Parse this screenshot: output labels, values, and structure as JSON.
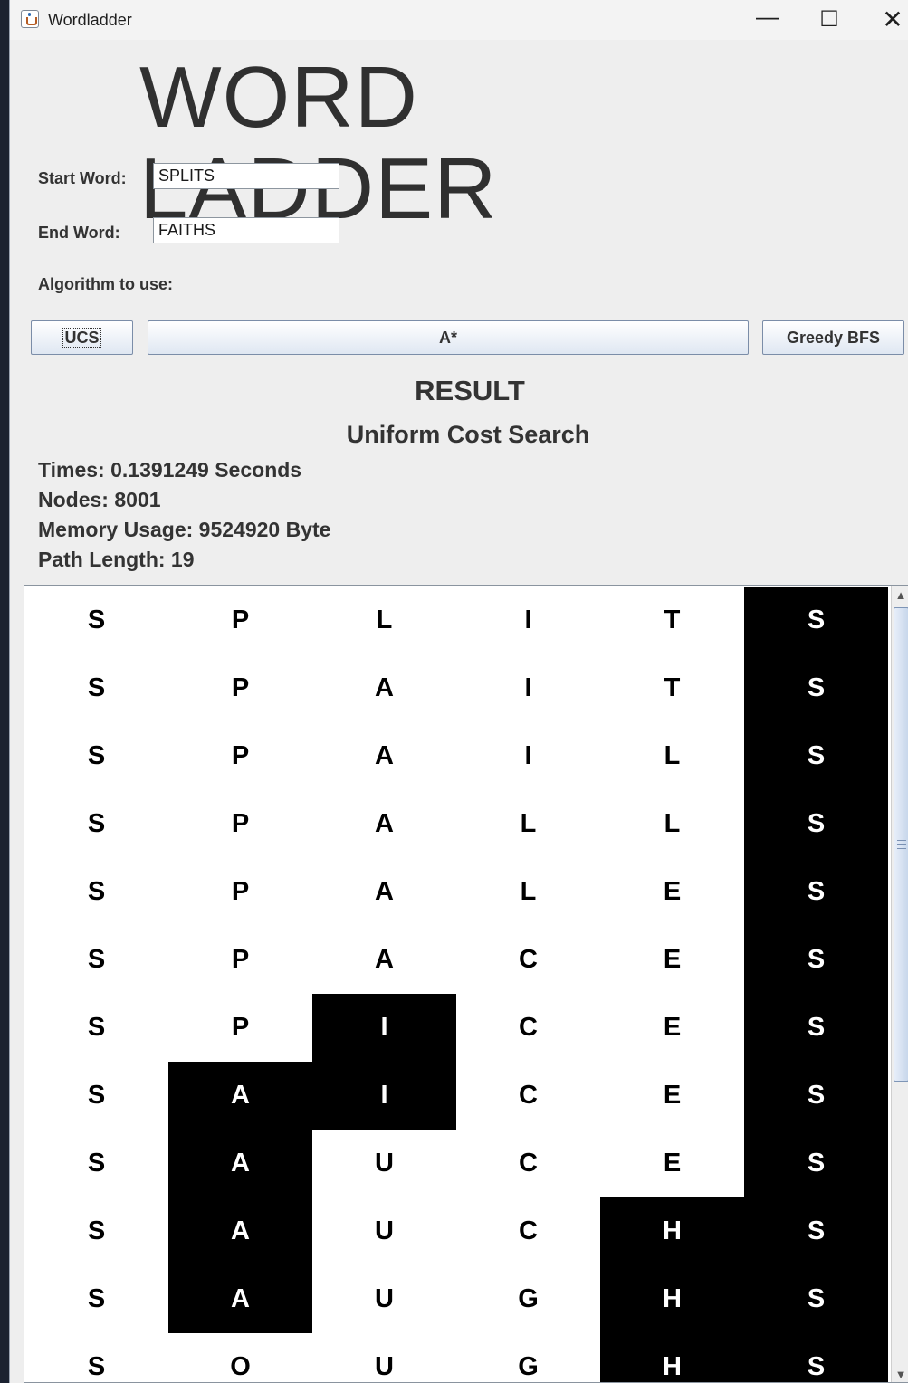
{
  "window": {
    "title": "Wordladder",
    "minimize_symbol": "—",
    "maximize_symbol": "☐",
    "close_symbol": "✕"
  },
  "heading": "WORD LADDER",
  "form": {
    "start_label": "Start Word:",
    "start_value": "SPLITS",
    "end_label": "End Word:",
    "end_value": "FAITHS",
    "algorithm_label": "Algorithm to use:"
  },
  "buttons": {
    "ucs": "UCS",
    "astar": "A*",
    "greedy": "Greedy BFS"
  },
  "result": {
    "title": "RESULT",
    "algorithm": "Uniform Cost Search",
    "time": "Times: 0.1391249 Seconds",
    "nodes": "Nodes: 8001",
    "memory": "Memory Usage: 9524920 Byte",
    "path_length": "Path Length: 19"
  },
  "ladder": [
    {
      "letters": [
        "S",
        "P",
        "L",
        "I",
        "T",
        "S"
      ],
      "highlight": [
        5
      ]
    },
    {
      "letters": [
        "S",
        "P",
        "A",
        "I",
        "T",
        "S"
      ],
      "highlight": [
        5
      ]
    },
    {
      "letters": [
        "S",
        "P",
        "A",
        "I",
        "L",
        "S"
      ],
      "highlight": [
        5
      ]
    },
    {
      "letters": [
        "S",
        "P",
        "A",
        "L",
        "L",
        "S"
      ],
      "highlight": [
        5
      ]
    },
    {
      "letters": [
        "S",
        "P",
        "A",
        "L",
        "E",
        "S"
      ],
      "highlight": [
        5
      ]
    },
    {
      "letters": [
        "S",
        "P",
        "A",
        "C",
        "E",
        "S"
      ],
      "highlight": [
        5
      ]
    },
    {
      "letters": [
        "S",
        "P",
        "I",
        "C",
        "E",
        "S"
      ],
      "highlight": [
        2,
        5
      ]
    },
    {
      "letters": [
        "S",
        "A",
        "I",
        "C",
        "E",
        "S"
      ],
      "highlight": [
        1,
        2,
        5
      ]
    },
    {
      "letters": [
        "S",
        "A",
        "U",
        "C",
        "E",
        "S"
      ],
      "highlight": [
        1,
        5
      ]
    },
    {
      "letters": [
        "S",
        "A",
        "U",
        "C",
        "H",
        "S"
      ],
      "highlight": [
        1,
        4,
        5
      ]
    },
    {
      "letters": [
        "S",
        "A",
        "U",
        "G",
        "H",
        "S"
      ],
      "highlight": [
        1,
        4,
        5
      ]
    },
    {
      "letters": [
        "S",
        "O",
        "U",
        "G",
        "H",
        "S"
      ],
      "highlight": [
        4,
        5
      ]
    }
  ],
  "scrollbar": {
    "up_arrow": "▲",
    "down_arrow": "▼"
  }
}
